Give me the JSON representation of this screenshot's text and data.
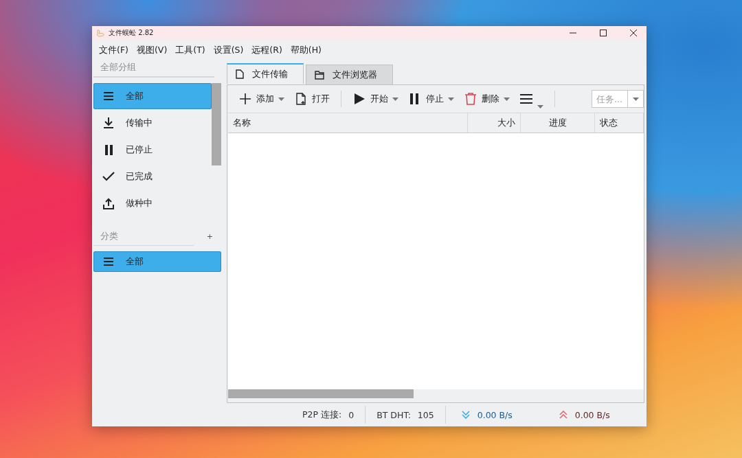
{
  "window": {
    "title": "文件蜈蚣 2.82"
  },
  "menu": [
    "文件(F)",
    "视图(V)",
    "工具(T)",
    "设置(S)",
    "远程(R)",
    "帮助(H)"
  ],
  "sidebar": {
    "groups_title": "全部分组",
    "groups": [
      {
        "kind": "all",
        "label": "全部",
        "selected": true
      },
      {
        "kind": "download",
        "label": "传输中",
        "selected": false
      },
      {
        "kind": "pause",
        "label": "已停止",
        "selected": false
      },
      {
        "kind": "check",
        "label": "已完成",
        "selected": false
      },
      {
        "kind": "upload",
        "label": "做种中",
        "selected": false
      }
    ],
    "categories_title": "分类",
    "add_label": "+",
    "categories": [
      {
        "kind": "all",
        "label": "全部",
        "selected": true
      }
    ]
  },
  "tabs": [
    {
      "kind": "file",
      "label": "文件传输",
      "selected": true
    },
    {
      "kind": "folder",
      "label": "文件浏览器",
      "selected": false
    }
  ],
  "toolbar": [
    {
      "kind": "add",
      "label": "添加",
      "dropdown": true
    },
    {
      "kind": "open",
      "label": "打开",
      "dropdown": false
    },
    {
      "kind": "sep"
    },
    {
      "kind": "play",
      "label": "开始",
      "dropdown": true
    },
    {
      "kind": "pause",
      "label": "停止",
      "dropdown": true
    },
    {
      "kind": "delete",
      "label": "删除",
      "dropdown": true
    },
    {
      "kind": "menu",
      "dropdown": true
    },
    {
      "kind": "sep"
    }
  ],
  "task_filter": {
    "placeholder": "任务..."
  },
  "table": {
    "columns": [
      {
        "label": "名称"
      },
      {
        "label": "大小"
      },
      {
        "label": "进度"
      },
      {
        "label": "状态"
      }
    ]
  },
  "status_bar": {
    "p2p_label": "P2P 连接:",
    "p2p_value": "0",
    "dht_label": "BT DHT:",
    "dht_value": "105",
    "down_speed": "0.00 B/s",
    "up_speed": "0.00 B/s"
  }
}
